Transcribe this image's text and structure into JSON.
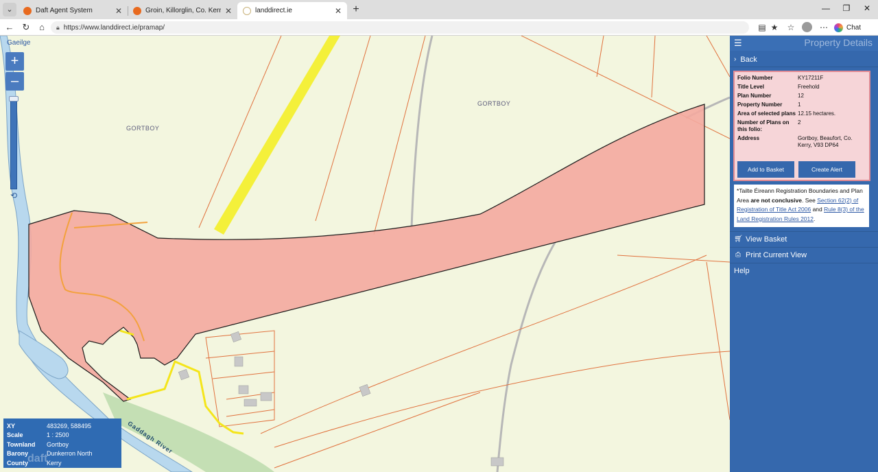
{
  "browser": {
    "tabs": [
      {
        "title": "Daft Agent System",
        "favicon_color": "#e86a1f",
        "active": false
      },
      {
        "title": "Groin, Killorglin, Co. Kerry, V93DV2",
        "favicon_color": "#e86a1f",
        "active": false
      },
      {
        "title": "landdirect.ie",
        "favicon_color": "#c9b27a",
        "active": true
      }
    ],
    "url": "https://www.landdirect.ie/pramap/",
    "chat_label": "Chat",
    "icons": [
      "tab-list-icon",
      "back-icon",
      "reload-icon",
      "home-icon",
      "lock-icon",
      "reader-icon",
      "favorite-star-icon",
      "favorites-icon",
      "profile-avatar",
      "more-icon",
      "minimize-icon",
      "restore-icon",
      "close-icon"
    ]
  },
  "map": {
    "language_link": "Gaeilge",
    "zoom_in": "+",
    "zoom_out": "–",
    "labels": {
      "townland_left": "GORTBOY",
      "townland_right": "GORTBOY",
      "river": "Gaddagh River"
    },
    "watermark": "daft",
    "info": {
      "xy_label": "XY",
      "xy_value": "483269, 588495",
      "scale_label": "Scale",
      "scale_value": "1 : 2500",
      "townland_label": "Townland",
      "townland_value": "Gortboy",
      "barony_label": "Barony",
      "barony_value": "Dunkerron North",
      "county_label": "County",
      "county_value": "Kerry"
    },
    "colors": {
      "background": "#f3f6df",
      "parcel_fill": "#f4aaa0",
      "boundary_line": "#e0703c",
      "road": "#f4f03a",
      "river": "#b8d8ee"
    }
  },
  "panel": {
    "title": "Property Details",
    "back_label": "Back",
    "property": {
      "folio_label": "Folio Number",
      "folio_value": "KY17211F",
      "title_level_label": "Title Level",
      "title_level_value": "Freehold",
      "plan_number_label": "Plan Number",
      "plan_number_value": "12",
      "property_number_label": "Property Number",
      "property_number_value": "1",
      "area_label": "Area of selected plans",
      "area_value": "12.15 hectares.",
      "num_plans_label": "Number of Plans on this folio:",
      "num_plans_value": "2",
      "address_label": "Address",
      "address_value": "Gortboy, Beaufort, Co. Kerry, V93 DP64"
    },
    "add_basket_label": "Add to Basket",
    "create_alert_label": "Create Alert",
    "note": {
      "part1": "*Tailte Éireann Registration Boundaries and Plan Area ",
      "bold": "are not conclusive",
      "part2": ". See ",
      "link1": "Section 62(2) of Registration of Title Act 2006",
      "part3": " and ",
      "link2": "Rule 8(3) of the Land Registration Rules 2012",
      "part4": "."
    },
    "view_basket_label": "View Basket",
    "print_label": "Print Current View",
    "help_label": "Help",
    "colors": {
      "panel_bg": "#3568ad",
      "prop_bg": "#f6d5d8",
      "prop_border": "#e08a93"
    }
  }
}
